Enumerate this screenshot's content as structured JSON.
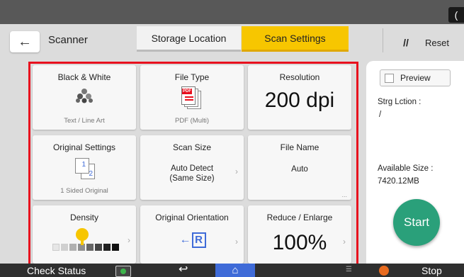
{
  "header": {
    "back_arrow": "←",
    "title": "Scanner",
    "tabs": [
      {
        "label": "Storage Location",
        "active": false
      },
      {
        "label": "Scan Settings",
        "active": true
      }
    ],
    "reset_label": "Reset",
    "reset_icon": "//"
  },
  "settings": {
    "color_mode": {
      "label": "Black & White",
      "value": "Text / Line Art",
      "icon": "dots-cluster-icon"
    },
    "file_type": {
      "label": "File Type",
      "value": "PDF (Multi)",
      "icon": "pdf-stack-icon",
      "icon_text": "PDF"
    },
    "resolution": {
      "label": "Resolution",
      "value": "200 dpi"
    },
    "original_settings": {
      "label": "Original Settings",
      "value": "1 Sided Original",
      "page_front": "1",
      "page_back": "2"
    },
    "scan_size": {
      "label": "Scan Size",
      "value_line1": "Auto Detect",
      "value_line2": "(Same Size)"
    },
    "file_name": {
      "label": "File Name",
      "value": "Auto",
      "more": "..."
    },
    "density": {
      "label": "Density"
    },
    "original_orientation": {
      "label": "Original Orientation",
      "icon_text": "R",
      "arrow": "←"
    },
    "reduce_enlarge": {
      "label": "Reduce / Enlarge",
      "value": "100%"
    }
  },
  "side_panel": {
    "preview_label": "Preview",
    "storage_label": "Strg Lction :",
    "storage_value": "/",
    "available_label": "Available Size :",
    "available_value": "7420.12MB",
    "start_label": "Start"
  },
  "bottom_bar": {
    "check_status": "Check Status",
    "stop_label": "Stop"
  },
  "colors": {
    "accent_tab": "#f7c600",
    "highlight_frame": "#e8101e",
    "start_button": "#2aa07a",
    "home_button": "#3f6bd8",
    "stop_icon": "#e86b1f"
  }
}
